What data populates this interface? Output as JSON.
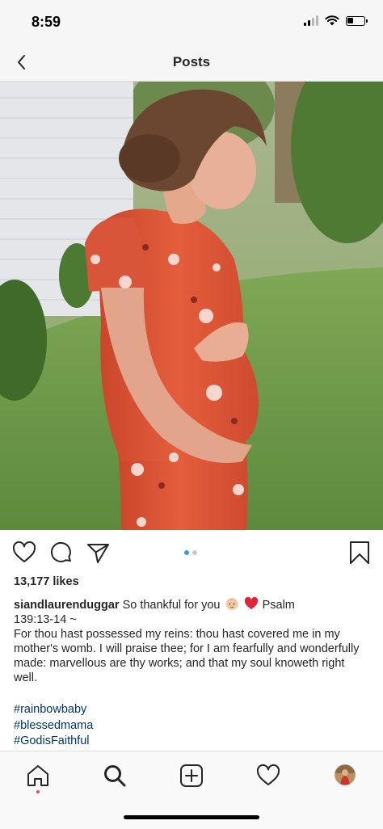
{
  "status_bar": {
    "time": "8:59",
    "icons": [
      "signal-icon",
      "wifi-icon",
      "battery-icon"
    ],
    "battery_level": 0.3
  },
  "header": {
    "title": "Posts",
    "back_icon": "chevron-left-icon"
  },
  "post": {
    "photo_alt": "pregnant woman in red floral dress",
    "carousel": {
      "count": 2,
      "active_index": 0
    },
    "actions": [
      "heart-icon",
      "comment-icon",
      "share-icon",
      "bookmark-icon"
    ],
    "likes": "13,177 likes",
    "caption": {
      "username": "siandlaurenduggar",
      "text_part1": "So thankful for you",
      "text_part2": "Psalm",
      "emojis": [
        "baby-face-emoji",
        "red-heart-emoji"
      ],
      "text_line2": "139:13-14 ~",
      "body": "For thou hast possessed my reins: thou hast covered me in my mother's womb. I will praise thee; for I am fearfully and wonderfully made: marvellous are thy works; and that my soul knoweth right well."
    },
    "hashtags": [
      "#rainbowbaby",
      "#blessedmama",
      "#GodisFaithful"
    ]
  },
  "bottom_nav": {
    "items": [
      "home-icon",
      "search-icon",
      "new-post-icon",
      "activity-heart-icon",
      "profile-avatar"
    ],
    "active": "home-icon",
    "notification_dot_color": "#ed4956"
  },
  "colors": {
    "hashtag": "#003569",
    "carousel_active": "#3897f0",
    "text": "#262626"
  }
}
